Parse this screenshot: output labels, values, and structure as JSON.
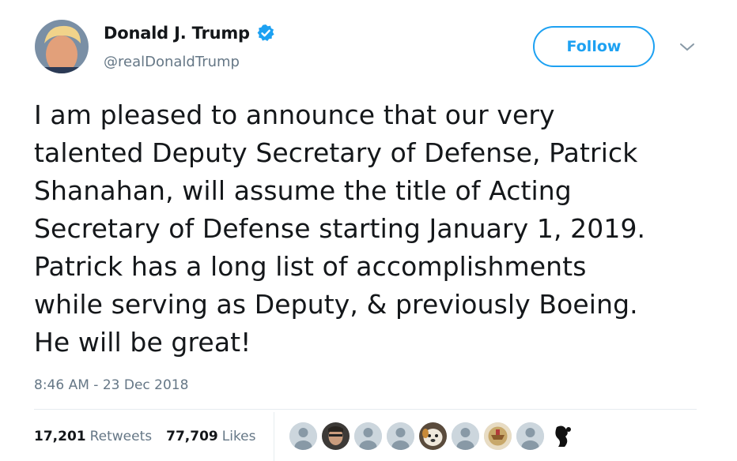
{
  "author": {
    "name": "Donald J. Trump",
    "handle": "@realDonaldTrump",
    "verified_icon": "verified-badge-icon"
  },
  "follow": {
    "label": "Follow"
  },
  "tweet": {
    "lines": [
      "I am pleased to announce that our very",
      "talented Deputy Secretary of Defense, Patrick",
      "Shanahan, will assume the title of Acting",
      "Secretary of Defense starting January 1, 2019.",
      "Patrick has a long list of accomplishments",
      "while serving as Deputy, & previously Boeing.",
      "He will be great!"
    ],
    "timestamp": "8:46 AM - 23 Dec 2018"
  },
  "stats": {
    "retweets_count": "17,201",
    "retweets_label": "Retweets",
    "likes_count": "77,709",
    "likes_label": "Likes"
  },
  "colors": {
    "accent": "#1da1f2",
    "secondary_text": "#657786",
    "divider": "#e6ecf0"
  }
}
